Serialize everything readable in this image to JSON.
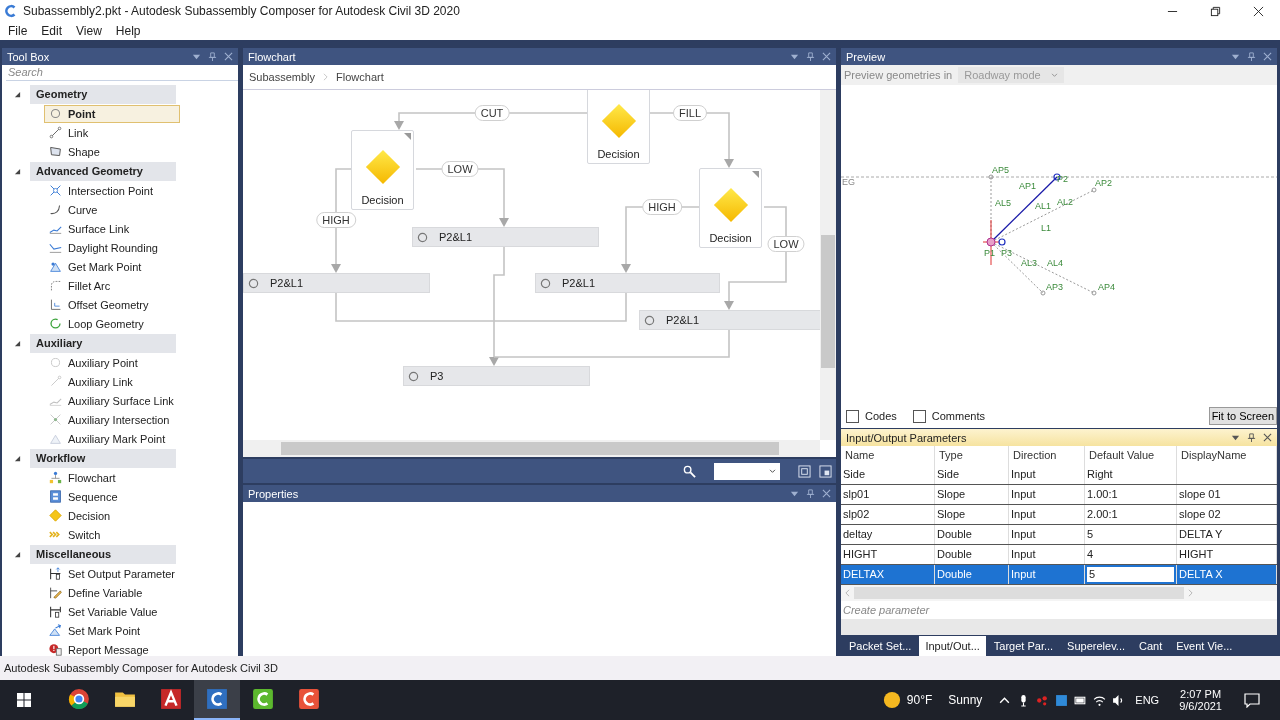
{
  "window": {
    "title": "Subassembly2.pkt - Autodesk Subassembly Composer for Autodesk Civil 3D 2020"
  },
  "menu": [
    "File",
    "Edit",
    "View",
    "Help"
  ],
  "toolbox": {
    "title": "Tool Box",
    "search_placeholder": "Search",
    "groups": [
      {
        "label": "Geometry",
        "expanded": true,
        "items": [
          {
            "label": "Point",
            "kind": "point",
            "selected": true
          },
          {
            "label": "Link",
            "kind": "link",
            "selected": false
          },
          {
            "label": "Shape",
            "kind": "shape",
            "selected": false
          }
        ]
      },
      {
        "label": "Advanced Geometry",
        "expanded": true,
        "items": [
          {
            "label": "Intersection Point",
            "kind": "intersection",
            "selected": false
          },
          {
            "label": "Curve",
            "kind": "curve",
            "selected": false
          },
          {
            "label": "Surface Link",
            "kind": "surface",
            "selected": false
          },
          {
            "label": "Daylight Rounding",
            "kind": "daylight",
            "selected": false
          },
          {
            "label": "Get Mark Point",
            "kind": "mark",
            "selected": false
          },
          {
            "label": "Fillet Arc",
            "kind": "fillet",
            "selected": false
          },
          {
            "label": "Offset Geometry",
            "kind": "offset",
            "selected": false
          },
          {
            "label": "Loop Geometry",
            "kind": "loop",
            "selected": false
          }
        ]
      },
      {
        "label": "Auxiliary",
        "expanded": true,
        "items": [
          {
            "label": "Auxiliary Point",
            "kind": "aux-point",
            "selected": false
          },
          {
            "label": "Auxiliary Link",
            "kind": "aux-link",
            "selected": false
          },
          {
            "label": "Auxiliary Surface Link",
            "kind": "aux-surface",
            "selected": false
          },
          {
            "label": "Auxiliary Intersection",
            "kind": "aux-intersection",
            "selected": false
          },
          {
            "label": "Auxiliary Mark Point",
            "kind": "aux-mark",
            "selected": false
          }
        ]
      },
      {
        "label": "Workflow",
        "expanded": true,
        "items": [
          {
            "label": "Flowchart",
            "kind": "flowchart",
            "selected": false
          },
          {
            "label": "Sequence",
            "kind": "sequence",
            "selected": false
          },
          {
            "label": "Decision",
            "kind": "decision",
            "selected": false
          },
          {
            "label": "Switch",
            "kind": "switch",
            "selected": false
          }
        ]
      },
      {
        "label": "Miscellaneous",
        "expanded": true,
        "items": [
          {
            "label": "Set Output Parameter",
            "kind": "output",
            "selected": false
          },
          {
            "label": "Define Variable",
            "kind": "variable",
            "selected": false
          },
          {
            "label": "Set Variable Value",
            "kind": "setvar",
            "selected": false
          },
          {
            "label": "Set Mark Point",
            "kind": "setmark",
            "selected": false
          },
          {
            "label": "Report Message",
            "kind": "message",
            "selected": false
          }
        ]
      }
    ]
  },
  "flowchart": {
    "title": "Flowchart",
    "breadcrumb": [
      "Subassembly",
      "Flowchart"
    ],
    "decisions": [
      "Decision",
      "Decision",
      "Decision"
    ],
    "branches": [
      "CUT",
      "FILL",
      "LOW",
      "HIGH",
      "HIGH",
      "LOW"
    ],
    "steps": [
      "P2&L1",
      "P2&L1",
      "P2&L1",
      "P2&L1",
      "P3"
    ]
  },
  "properties": {
    "title": "Properties"
  },
  "preview": {
    "title": "Preview",
    "mode_label": "Preview geometries in",
    "mode": "Roadway mode",
    "geometry_labels": [
      "EG",
      "AP5",
      "AP1",
      "P2",
      "AP2",
      "AL5",
      "AL1",
      "L1",
      "AL2",
      "P1",
      "P3",
      "AL3",
      "AL4",
      "AP3",
      "AP4"
    ],
    "checkboxes": [
      {
        "label": "Codes",
        "checked": false
      },
      {
        "label": "Comments",
        "checked": false
      }
    ],
    "fit_button": "Fit to Screen"
  },
  "parameters": {
    "title": "Input/Output Parameters",
    "columns": [
      "Name",
      "Type",
      "Direction",
      "Default Value",
      "DisplayName"
    ],
    "rows": [
      {
        "cells": [
          "Side",
          "Side",
          "Input",
          "Right",
          ""
        ],
        "selected": false,
        "editing": false
      },
      {
        "cells": [
          "slp01",
          "Slope",
          "Input",
          "1.00:1",
          "slope 01"
        ],
        "selected": false,
        "editing": false
      },
      {
        "cells": [
          "slp02",
          "Slope",
          "Input",
          "2.00:1",
          "slope 02"
        ],
        "selected": false,
        "editing": false
      },
      {
        "cells": [
          "deltay",
          "Double",
          "Input",
          "5",
          "DELTA Y"
        ],
        "selected": false,
        "editing": false
      },
      {
        "cells": [
          "HIGHT",
          "Double",
          "Input",
          "4",
          "HIGHT"
        ],
        "selected": false,
        "editing": false
      },
      {
        "cells": [
          "DELTAX",
          "Double",
          "Input",
          "5",
          "DELTA X"
        ],
        "selected": true,
        "editing": true
      }
    ],
    "create_placeholder": "Create parameter"
  },
  "bottom_tabs": [
    {
      "label": "Packet Set...",
      "selected": false
    },
    {
      "label": "Input/Out...",
      "selected": true
    },
    {
      "label": "Target Par...",
      "selected": false
    },
    {
      "label": "Superelev...",
      "selected": false
    },
    {
      "label": "Cant",
      "selected": false
    },
    {
      "label": "Event Vie...",
      "selected": false
    }
  ],
  "status_bar": "Autodesk Subassembly Composer for Autodesk Civil 3D",
  "taskbar": {
    "apps": [
      {
        "kind": "browser",
        "selected": false
      },
      {
        "kind": "folder",
        "selected": false
      },
      {
        "kind": "red-a",
        "selected": false
      },
      {
        "kind": "blue-c",
        "selected": true
      },
      {
        "kind": "green-c",
        "selected": false
      },
      {
        "kind": "red-c",
        "selected": false
      }
    ],
    "temperature": "90°F",
    "weather": "Sunny",
    "language": "ENG",
    "time": "2:07 PM",
    "date": "9/6/2021"
  }
}
